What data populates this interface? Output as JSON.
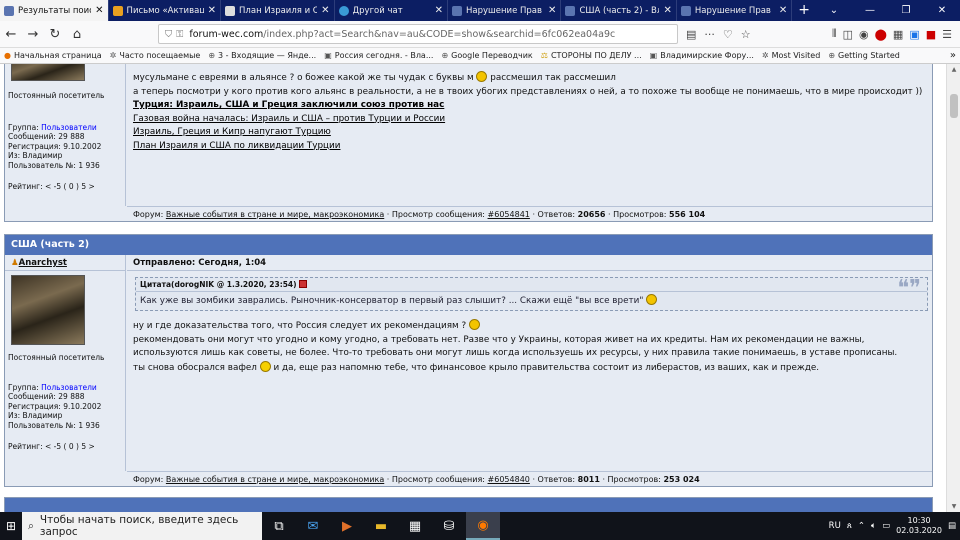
{
  "browser": {
    "tabs": [
      {
        "label": "Результаты поиска",
        "color": "#5a74b0",
        "active": true
      },
      {
        "label": "Письмо «Активаци",
        "color": "#e8a020",
        "active": false
      },
      {
        "label": "План Израиля и С",
        "color": "#dddddd",
        "active": false
      },
      {
        "label": "Другой чат",
        "color": "#3a9bd5",
        "active": false
      },
      {
        "label": "Нарушение Прав",
        "color": "#5a74b0",
        "active": false
      },
      {
        "label": "США (часть 2) - Вл",
        "color": "#5a74b0",
        "active": false
      },
      {
        "label": "Нарушение Прав",
        "color": "#5a74b0",
        "active": false
      }
    ],
    "url_host": "forum-wec.com",
    "url_path": "/index.php?act=Search&nav=au&CODE=show&searchid=6fc062ea04a9c",
    "bookmarks": [
      "Начальная страница",
      "Часто посещаемые",
      "3 - Входящие — Янде...",
      "Россия сегодня. - Вла...",
      "Google Переводчик",
      "СТОРОНЫ ПО ДЕЛУ ...",
      "Владимирские Фору...",
      "Most Visited",
      "Getting Started"
    ]
  },
  "post1": {
    "user_status": "Постоянный посетитель",
    "group_label": "Группа:",
    "group": "Пользователи",
    "messages": "Сообщений: 29 888",
    "registered": "Регистрация: 9.10.2002",
    "from": "Из: Владимир",
    "user_no": "Пользователь №: 1 936",
    "rating": "Рейтинг: < -5 ( 0 ) 5 >",
    "line1": "мусульмане с евреями в альянсе ? о божее какой же ты чудак с буквы м",
    "line1b": "рассмешил так рассмешил",
    "line2": "а теперь посмотри у кого против кого альянс в реальности, а не в твоих убогих представлениях о ней, а то похоже ты вообще не понимаешь, что в мире происходит ))",
    "links": [
      "Турция: Израиль, США и Греция заключили союз против нас",
      "Газовая война началась: Израиль и США – против Турции и России",
      "Израиль, Греция и Кипр напугают Турцию",
      "План Израиля и США по ликвидации Турции"
    ],
    "footer": {
      "forum_label": "Форум:",
      "forum": "Важные события в стране и мире, макроэкономика",
      "view_label": "· Просмотр сообщения:",
      "post_id": "#6054841",
      "answers_label": "· Ответов:",
      "answers": "20656",
      "views_label": "· Просмотров:",
      "views": "556 104"
    }
  },
  "post2": {
    "title": "США (часть 2)",
    "author": "Anarchyst",
    "sent": "Отправлено: Сегодня, 1:04",
    "user_status": "Постоянный посетитель",
    "group_label": "Группа:",
    "group": "Пользователи",
    "messages": "Сообщений: 29 888",
    "registered": "Регистрация: 9.10.2002",
    "from": "Из: Владимир",
    "user_no": "Пользователь №: 1 936",
    "rating": "Рейтинг: < -5 ( 0 ) 5 >",
    "quote_head": "Цитата(dorogNIK @ 1.3.2020, 23:54)",
    "quote_text": "Как уже вы зомбики заврались. Рыночник-консерватор в первый раз слышит? ... Скажи ещё \"вы все врети\"",
    "line1": "ну и где доказательства того, что Россия следует их рекомендациям ?",
    "line2": "рекомендовать они могут что угодно и кому угодно, а требовать нет. Разве что у Украины, которая живет на их кредиты. Нам их рекомендации не важны, используются лишь как советы, не более. Что-то требовать они могут лишь когда используешь их ресурсы, у них правила такие понимаешь, в уставе прописаны.",
    "line3a": "ты снова обосрался вафел",
    "line3b": "и да, еще раз напомню тебе, что финансовое крыло правительства состоит из либерастов, из ваших, как и прежде.",
    "footer": {
      "forum_label": "Форум:",
      "forum": "Важные события в стране и мире, макроэкономика",
      "view_label": "· Просмотр сообщения:",
      "post_id": "#6054840",
      "answers_label": "· Ответов:",
      "answers": "8011",
      "views_label": "· Просмотров:",
      "views": "253 024"
    }
  },
  "taskbar": {
    "search_placeholder": "Чтобы начать поиск, введите здесь запрос",
    "lang": "RU",
    "time": "10:30",
    "date": "02.03.2020"
  }
}
